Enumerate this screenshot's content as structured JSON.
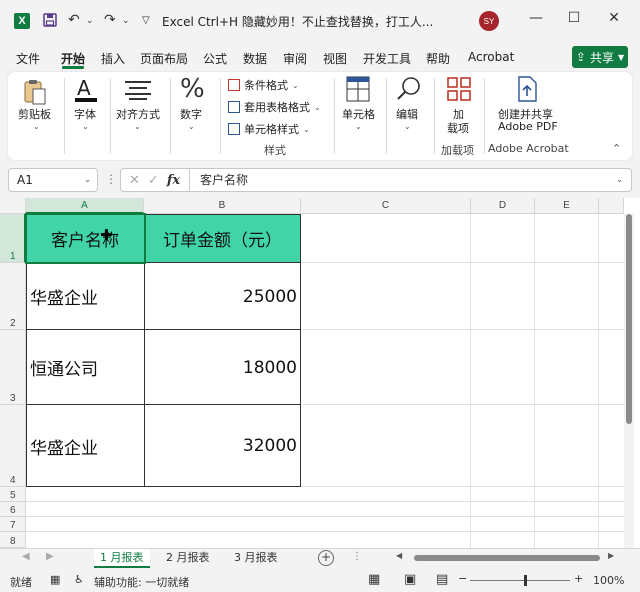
{
  "app": {
    "logo": "X",
    "title": "Excel Ctrl+H 隐藏妙用！不止查找替换，打工人...",
    "user_initials": "SY"
  },
  "quick_access": {
    "save_icon": "save-icon",
    "undo_icon": "undo-icon",
    "redo_icon": "redo-icon",
    "more_icon": "chevron-down-icon"
  },
  "window": {
    "minimize": "—",
    "maximize": "☐",
    "close": "✕"
  },
  "menu": {
    "tabs": [
      "文件",
      "开始",
      "插入",
      "页面布局",
      "公式",
      "数据",
      "审阅",
      "视图",
      "开发工具",
      "帮助",
      "Acrobat"
    ],
    "active": "开始",
    "share": "共享"
  },
  "ribbon": {
    "paste": "剪贴板",
    "font": "字体",
    "align": "对齐方式",
    "number": "数字",
    "cond_format": "条件格式",
    "table_format": "套用表格格式",
    "cell_style": "单元格样式",
    "styles_caption": "样式",
    "cells": "单元格",
    "edit": "编辑",
    "addins_line1": "加",
    "addins_line2": "载项",
    "addins_caption": "加载项",
    "acrobat_line1": "创建并共享",
    "acrobat_line2": "Adobe PDF",
    "acrobat_caption": "Adobe Acrobat"
  },
  "formula_bar": {
    "name_box": "A1",
    "fx": "fx",
    "content": "客户名称"
  },
  "columns": [
    "A",
    "B",
    "C",
    "D",
    "E"
  ],
  "rows": [
    "1",
    "2",
    "3",
    "4",
    "5",
    "6",
    "7",
    "8"
  ],
  "table": {
    "headers": [
      "客户名称",
      "订单金额（元）"
    ],
    "header_color": "#40d4a6",
    "rows": [
      [
        "华盛企业",
        "25000"
      ],
      [
        "恒通公司",
        "18000"
      ],
      [
        "华盛企业",
        "32000"
      ]
    ]
  },
  "sheets": {
    "tabs": [
      "1 月报表",
      "2 月报表",
      "3 月报表"
    ],
    "active": "1 月报表"
  },
  "status": {
    "ready": "就绪",
    "accessibility": "辅助功能: 一切就绪",
    "zoom": "100%"
  },
  "colors": {
    "accent": "#107c41"
  }
}
